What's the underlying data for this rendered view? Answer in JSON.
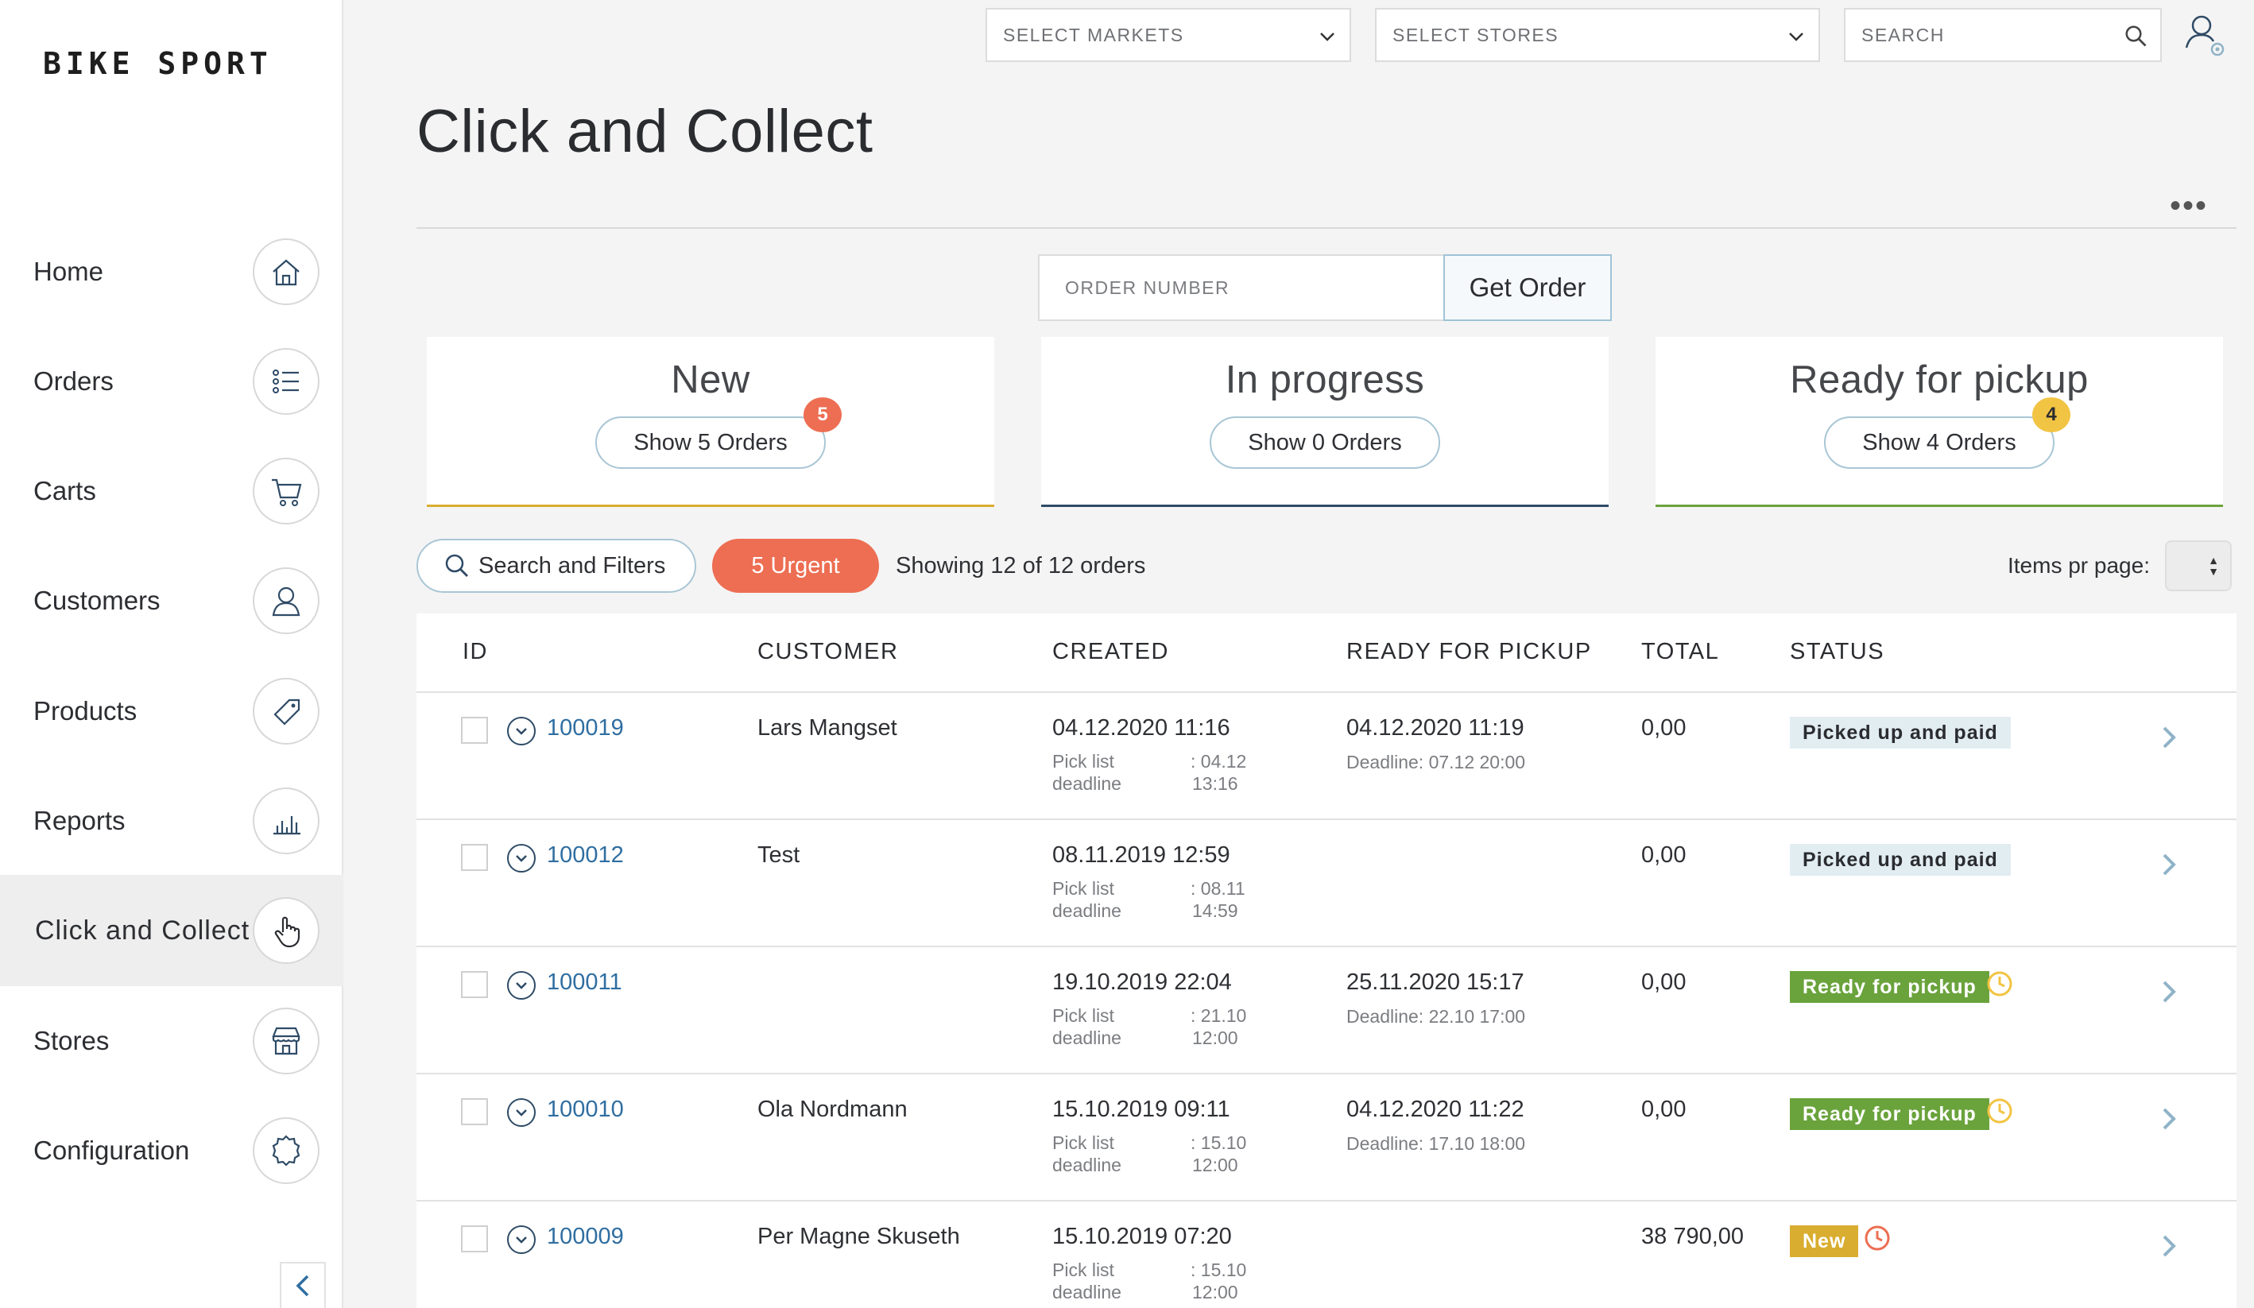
{
  "sidebar": {
    "logo": "BIKE SPORT",
    "items": [
      {
        "label": "Home",
        "icon": "home-icon"
      },
      {
        "label": "Orders",
        "icon": "list-icon"
      },
      {
        "label": "Carts",
        "icon": "cart-icon"
      },
      {
        "label": "Customers",
        "icon": "person-icon"
      },
      {
        "label": "Products",
        "icon": "tag-icon"
      },
      {
        "label": "Reports",
        "icon": "bar-chart-icon"
      },
      {
        "label": "Click and Collect",
        "icon": "hand-pointer-icon",
        "active": true
      },
      {
        "label": "Stores",
        "icon": "store-icon"
      },
      {
        "label": "Configuration",
        "icon": "gear-icon"
      }
    ]
  },
  "topbar": {
    "markets_placeholder": "SELECT MARKETS",
    "stores_placeholder": "SELECT STORES",
    "search_placeholder": "SEARCH"
  },
  "page": {
    "title": "Click and Collect",
    "more": "•••"
  },
  "lookup": {
    "placeholder": "ORDER NUMBER",
    "button": "Get Order"
  },
  "cards": [
    {
      "title": "New",
      "button": "Show 5 Orders",
      "badge": "5",
      "accent": "#d9ad2f",
      "badge_color": "#ed6e53"
    },
    {
      "title": "In progress",
      "button": "Show 0 Orders",
      "badge": "",
      "accent": "#2f4b66",
      "badge_color": ""
    },
    {
      "title": "Ready for pickup",
      "button": "Show 4 Orders",
      "badge": "4",
      "accent": "#6aa33c",
      "badge_color": "#f2c443"
    }
  ],
  "filters": {
    "search_label": "Search and Filters",
    "urgent_label": "5 Urgent",
    "showing": "Showing 12 of 12 orders",
    "items_per_page_label": "Items pr page:"
  },
  "table": {
    "columns": [
      "ID",
      "CUSTOMER",
      "CREATED",
      "READY FOR PICKUP",
      "TOTAL",
      "STATUS"
    ],
    "rows": [
      {
        "id": "100019",
        "customer": "Lars Mangset",
        "created": "04.12.2020 11:16",
        "pick_label_1": "Pick list",
        "pick_label_2": "deadline",
        "pick_val_1": ": 04.12",
        "pick_val_2": "13:16",
        "ready": "04.12.2020 11:19",
        "deadline": "Deadline: 07.12 20:00",
        "total": "0,00",
        "status": "Picked up and paid",
        "status_type": "paid",
        "clock": ""
      },
      {
        "id": "100012",
        "customer": "Test",
        "created": "08.11.2019 12:59",
        "pick_label_1": "Pick list",
        "pick_label_2": "deadline",
        "pick_val_1": ": 08.11",
        "pick_val_2": "14:59",
        "ready": "",
        "deadline": "",
        "total": "0,00",
        "status": "Picked up and paid",
        "status_type": "paid",
        "clock": ""
      },
      {
        "id": "100011",
        "customer": "",
        "created": "19.10.2019 22:04",
        "pick_label_1": "Pick list",
        "pick_label_2": "deadline",
        "pick_val_1": ": 21.10",
        "pick_val_2": "12:00",
        "ready": "25.11.2020 15:17",
        "deadline": "Deadline: 22.10 17:00",
        "total": "0,00",
        "status": "Ready for pickup",
        "status_type": "ready",
        "clock": "#f2c443"
      },
      {
        "id": "100010",
        "customer": "Ola Nordmann",
        "created": "15.10.2019 09:11",
        "pick_label_1": "Pick list",
        "pick_label_2": "deadline",
        "pick_val_1": ": 15.10",
        "pick_val_2": "12:00",
        "ready": "04.12.2020 11:22",
        "deadline": "Deadline: 17.10 18:00",
        "total": "0,00",
        "status": "Ready for pickup",
        "status_type": "ready",
        "clock": "#f2c443"
      },
      {
        "id": "100009",
        "customer": "Per Magne Skuseth",
        "created": "15.10.2019 07:20",
        "pick_label_1": "Pick list",
        "pick_label_2": "deadline",
        "pick_val_1": ": 15.10",
        "pick_val_2": "12:00",
        "ready": "",
        "deadline": "",
        "total": "38 790,00",
        "status": "New",
        "status_type": "new",
        "clock": "#ed6e53"
      }
    ]
  }
}
